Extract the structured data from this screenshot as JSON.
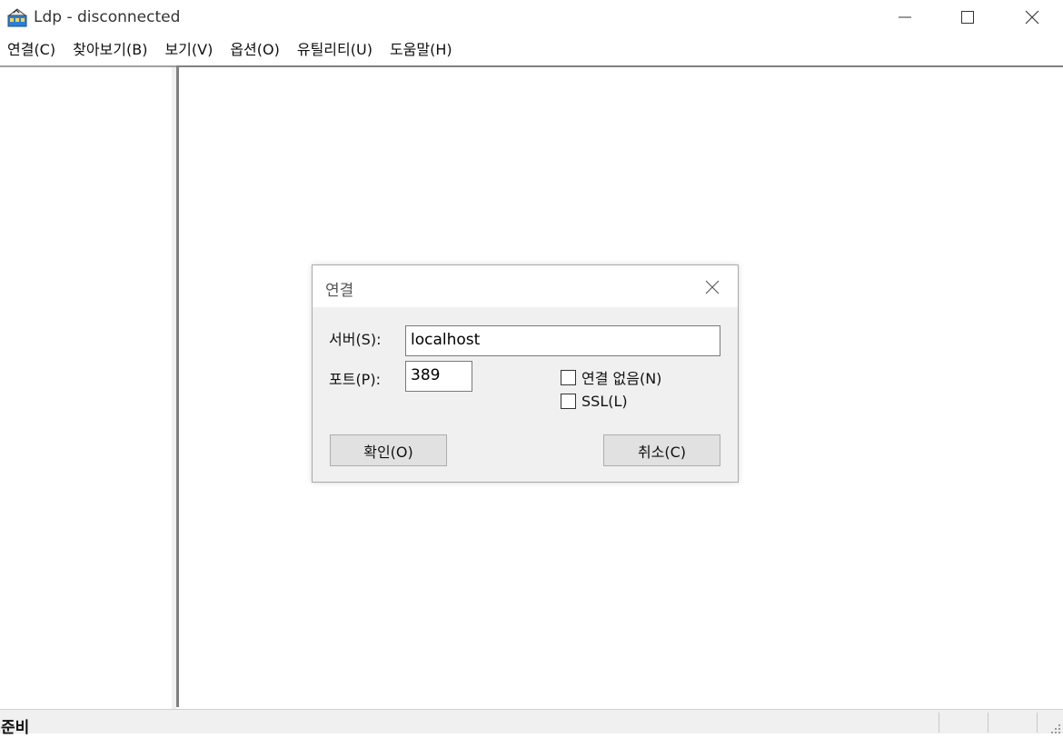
{
  "window": {
    "title": "Ldp - disconnected",
    "icon": "ldp-app-icon"
  },
  "menu": [
    {
      "label": "연결(C)"
    },
    {
      "label": "찾아보기(B)"
    },
    {
      "label": "보기(V)"
    },
    {
      "label": "옵션(O)"
    },
    {
      "label": "유틸리티(U)"
    },
    {
      "label": "도움말(H)"
    }
  ],
  "status": {
    "text": "준비"
  },
  "dialog": {
    "title": "연결",
    "server_label": "서버(S):",
    "server_value": "localhost",
    "port_label": "포트(P):",
    "port_value": "389",
    "connectionless_label": "연결 없음(N)",
    "connectionless_checked": false,
    "ssl_label": "SSL(L)",
    "ssl_checked": false,
    "ok_label": "확인(O)",
    "cancel_label": "취소(C)"
  },
  "colors": {
    "dialog_bg": "#f0f0f0",
    "button_bg": "#e1e1e1",
    "pane_border": "#808080"
  }
}
